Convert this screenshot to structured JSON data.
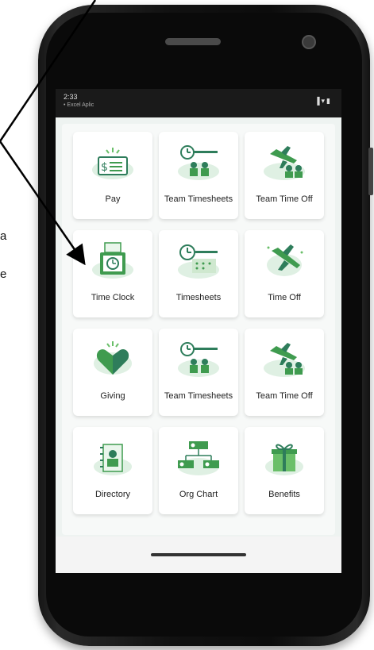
{
  "status": {
    "time": "2:33",
    "subtitle": "• Excel Aplic",
    "icons": "▐▾▮"
  },
  "edge_text": {
    "line1": "a",
    "line2": "e"
  },
  "tiles": [
    {
      "label": "Pay",
      "icon": "pay-icon"
    },
    {
      "label": "Team Timesheets",
      "icon": "team-timesheets-icon"
    },
    {
      "label": "Team Time Off",
      "icon": "team-time-off-icon"
    },
    {
      "label": "Time Clock",
      "icon": "time-clock-icon"
    },
    {
      "label": "Timesheets",
      "icon": "timesheets-icon"
    },
    {
      "label": "Time Off",
      "icon": "time-off-icon"
    },
    {
      "label": "Giving",
      "icon": "giving-icon"
    },
    {
      "label": "Team Timesheets",
      "icon": "team-timesheets-icon"
    },
    {
      "label": "Team Time Off",
      "icon": "team-time-off-icon"
    },
    {
      "label": "Directory",
      "icon": "directory-icon"
    },
    {
      "label": "Org Chart",
      "icon": "org-chart-icon"
    },
    {
      "label": "Benefits",
      "icon": "benefits-icon"
    }
  ],
  "colors": {
    "accent_green": "#3f9b4f",
    "light_green": "#cfe8cf",
    "teal": "#2e7d5b"
  }
}
